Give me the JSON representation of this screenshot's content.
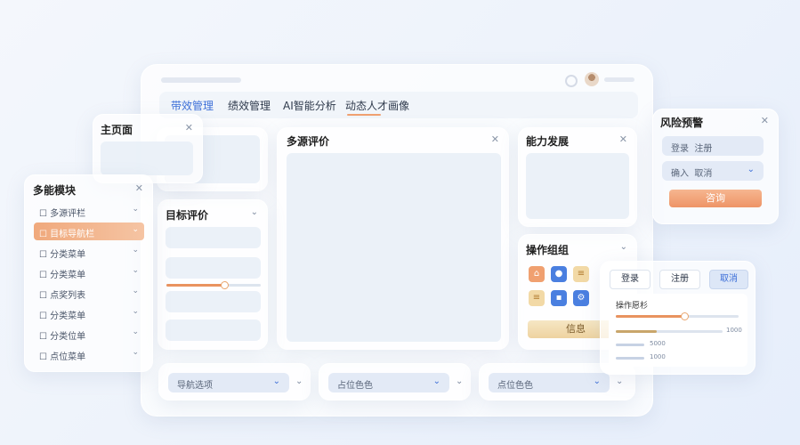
{
  "tabs": [
    "带效管理",
    "绩效管理",
    "AI智能分析",
    "动态人才画像"
  ],
  "home": {
    "title": "主页面"
  },
  "multi": {
    "title": "多能模块",
    "items": [
      "多源评栏",
      "目标导航栏",
      "分类菜单",
      "分类菜单",
      "点奖列表",
      "分类菜单",
      "分类位单",
      "点位菜单"
    ]
  },
  "target": {
    "title": "目标评价",
    "progress": 0.6
  },
  "source": {
    "title": "多源评价"
  },
  "ability": {
    "title": "能力发展"
  },
  "ops": {
    "title": "操作组组",
    "info_label": "信息"
  },
  "risk": {
    "title": "风险预警",
    "login": "登录",
    "register": "注册",
    "input": "确入",
    "cancel": "取消",
    "query": "咨询"
  },
  "panel": {
    "login": "登录",
    "register": "注册",
    "cancel": "取消",
    "label": "操作愿杉",
    "slider_value": 0.55,
    "val1": "1000",
    "val2": "5000",
    "val3": "1000"
  },
  "bottom": {
    "sel1": "导航选项",
    "sel2": "占位色色",
    "sel3": "点位色色"
  },
  "colors": {
    "accent": "#f0a070",
    "primary": "#3d6fd8"
  },
  "icons": [
    "home-icon",
    "user-icon",
    "list-icon",
    "list-icon",
    "save-icon",
    "gear-icon"
  ]
}
